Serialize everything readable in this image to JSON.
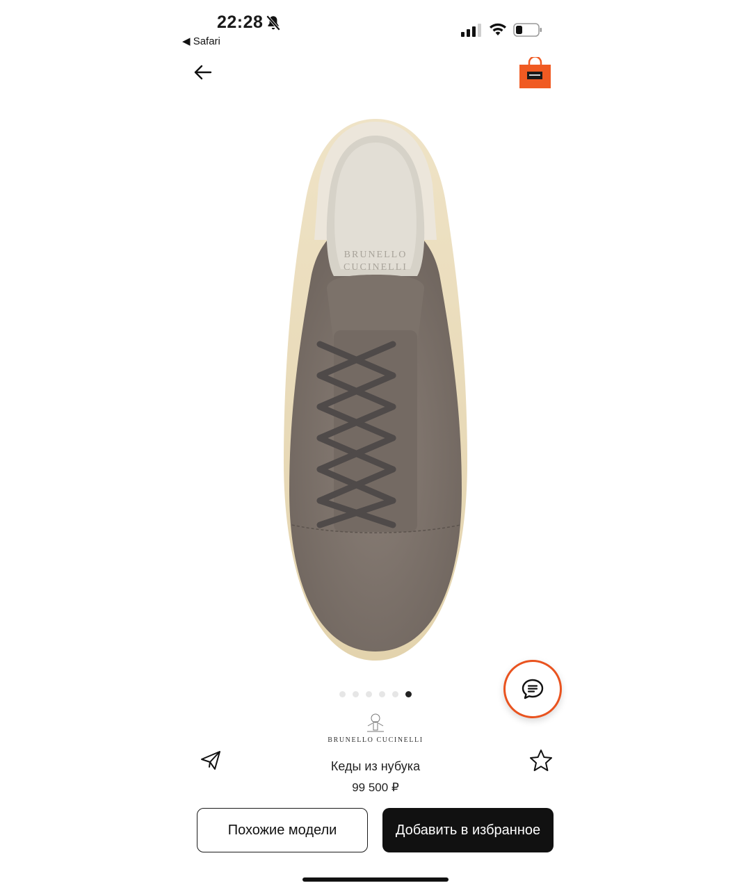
{
  "status_bar": {
    "time": "22:28",
    "back_app": "◀ Safari",
    "icons": [
      "bell-slash-icon",
      "cellular-signal-icon",
      "wifi-icon",
      "battery-icon"
    ]
  },
  "nav": {
    "back_icon": "arrow-left-icon",
    "bag_icon": "shopping-bag-icon",
    "bag_color": "#f05a22"
  },
  "product": {
    "image_brand_text_line1": "BRUNELLO",
    "image_brand_text_line2": "CUCINELLI",
    "brand": "BRUNELLO CUCINELLI",
    "title": "Кеды из нубука",
    "price": "99 500 ₽"
  },
  "carousel": {
    "total": 6,
    "active_index": 5
  },
  "actions": {
    "similar_label": "Похожие модели",
    "add_favorite_label": "Добавить в избранное",
    "share_icon": "paper-plane-icon",
    "favorite_icon": "star-icon",
    "chat_icon": "chat-bubble-icon"
  },
  "colors": {
    "accent": "#e9531f",
    "primary_button": "#111111"
  }
}
